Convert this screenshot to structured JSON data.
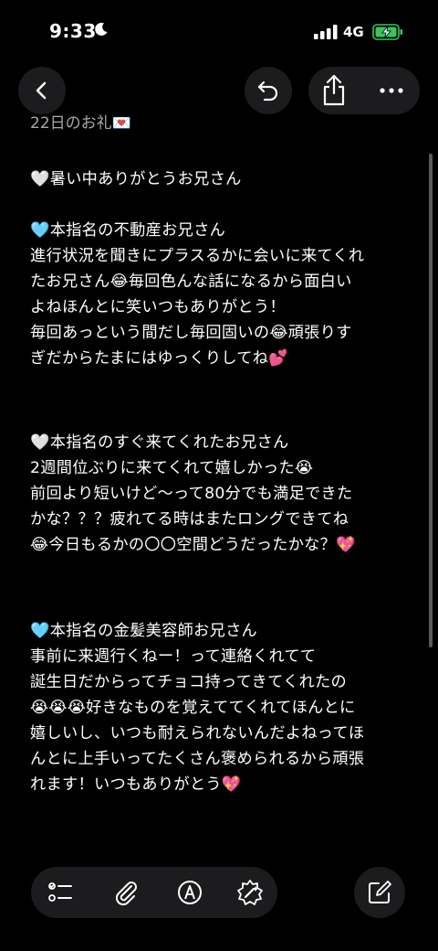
{
  "status_bar": {
    "time": "9:33",
    "network": "4G"
  },
  "header": {
    "back_icon": "chevron-left-icon",
    "undo_icon": "undo-icon",
    "share_icon": "share-icon",
    "more_icon": "ellipsis-icon"
  },
  "note": {
    "title": "22日のお礼💌",
    "lines": [
      "🤍暑い中ありがとうお兄さん",
      "",
      "🩵本指名の不動産お兄さん",
      "進行状況を聞きにプラスるかに会いに来てくれ",
      "たお兄さん😂毎回色んな話になるから面白い",
      "よねほんとに笑いつもありがとう！",
      "毎回あっという間だし毎回固いの😂頑張りす",
      "ぎだからたまにはゆっくりしてね💕",
      "",
      "",
      "🤍本指名のすぐ来てくれたお兄さん",
      "2週間位ぶりに来てくれて嬉しかった😭",
      "前回より短いけど〜って80分でも満足できた",
      "かな？？？疲れてる時はまたロングできてね",
      "😂今日もるかの〇〇空間どうだったかな？💖",
      "",
      "",
      "🩵本指名の金髪美容師お兄さん",
      "事前に来週行くねー！って連絡くれてて",
      "誕生日だからってチョコ持ってきてくれたの",
      "😭😭😭好きなものを覚えててくれてほんとに",
      "嬉しいし、いつも耐えられないんだよねってほ",
      "んとに上手いってたくさん褒められるから頑張",
      "れます！いつもありがとう💖"
    ]
  },
  "toolbar": {
    "icons": [
      "checklist-icon",
      "paperclip-icon",
      "markup-icon",
      "writing-tools-icon"
    ],
    "compose_icon": "compose-icon"
  },
  "colors": {
    "background": "#000000",
    "button_bg": "#1c1c1e",
    "title_gray": "#a8a8a8",
    "battery_green": "#34c759"
  }
}
